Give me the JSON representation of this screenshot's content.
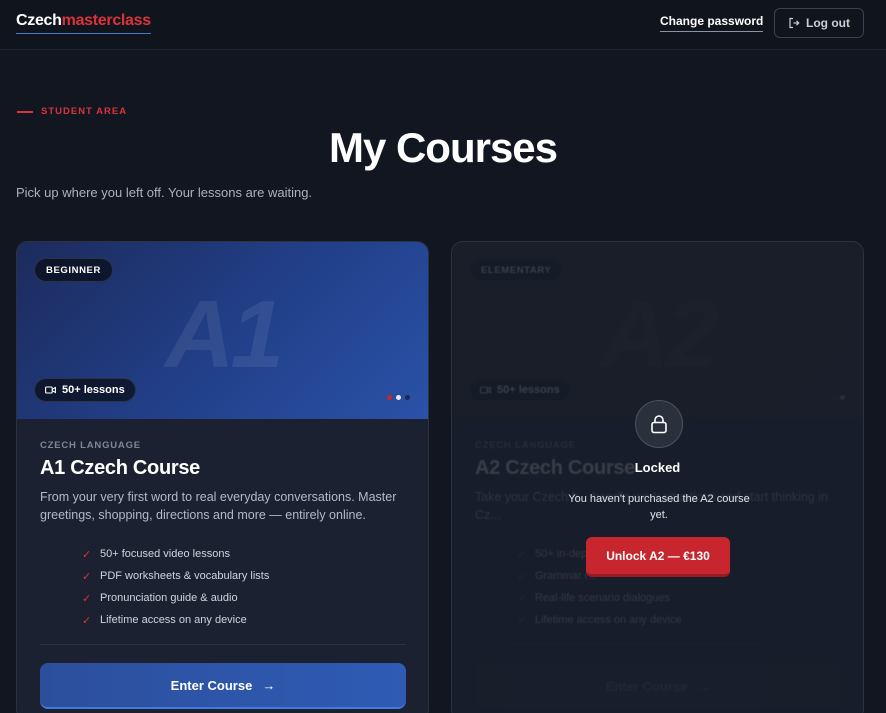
{
  "header": {
    "logo_part1": "Czech",
    "logo_part2": "masterclass",
    "change_password": "Change password",
    "logout": "Log out"
  },
  "hero": {
    "eyebrow": "STUDENT AREA",
    "title": "My Courses",
    "subtitle": "Pick up where you left off. Your lessons are waiting."
  },
  "courses": [
    {
      "badge": "BEGINNER",
      "level": "A1",
      "lessons": "50+ lessons",
      "kicker": "CZECH LANGUAGE",
      "title": "A1 Czech Course",
      "description": "From your very first word to real everyday conversations. Master greetings, shopping, directions and more — entirely online.",
      "features": [
        "50+ focused video lessons",
        "PDF worksheets & vocabulary lists",
        "Pronunciation guide & audio",
        "Lifetime access on any device"
      ],
      "button": "Enter Course"
    },
    {
      "badge": "ELEMENTARY",
      "level": "A2",
      "lessons": "50+ lessons",
      "kicker": "CZECH LANGUAGE",
      "title": "A2 Czech Course",
      "description": "Take your Czech h... handle work situations and start thinking in Cz...",
      "features": [
        "50+ in-dep...",
        "Grammar r...",
        "Real-life scenario dialogues",
        "Lifetime access on any device"
      ],
      "button": "Enter Course",
      "lock": {
        "label": "Locked",
        "message": "You haven't purchased the A2 course yet.",
        "unlock_button": "Unlock A2 — €130"
      }
    }
  ],
  "colors": {
    "accent_red": "#d9343b",
    "accent_blue": "#2f5bb5",
    "background": "#121620"
  }
}
